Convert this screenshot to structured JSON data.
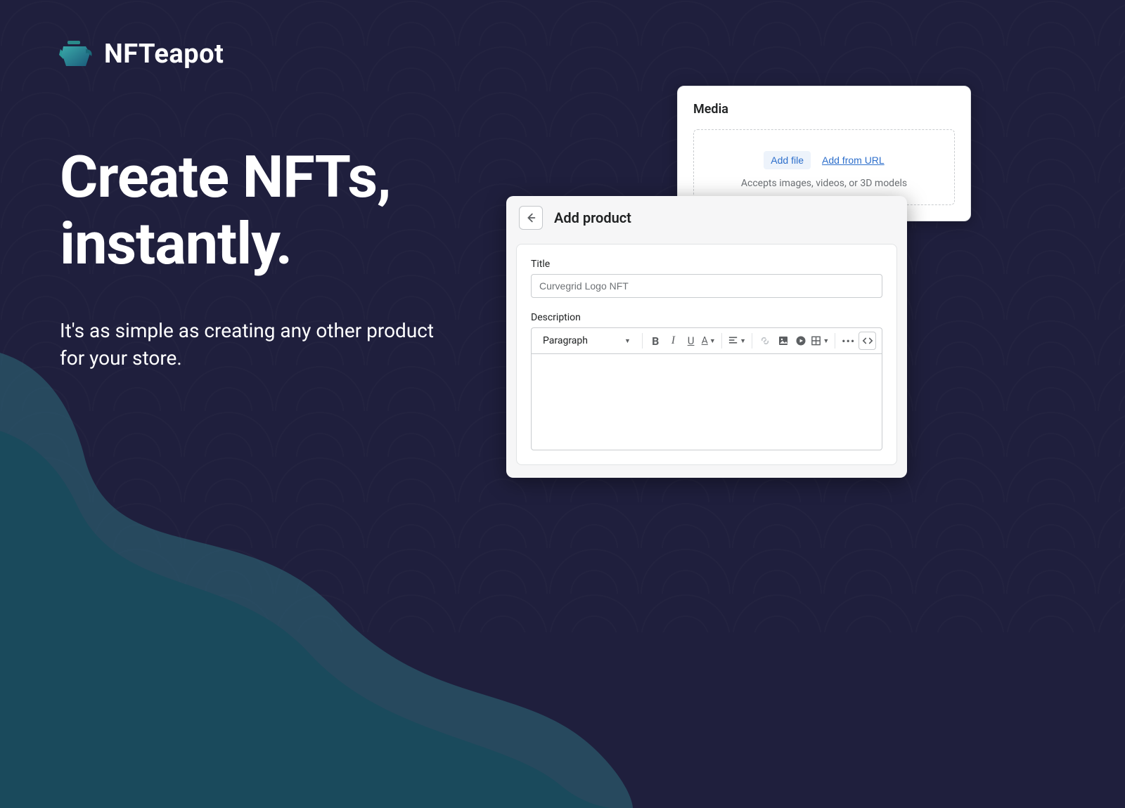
{
  "brand": {
    "name": "NFTeapot"
  },
  "hero": {
    "title_l1": "Create NFTs,",
    "title_l2": "instantly.",
    "subtitle": "It's as simple as creating any other product for your store."
  },
  "media": {
    "heading": "Media",
    "add_file": "Add file",
    "add_url": "Add from URL",
    "hint": "Accepts images, videos, or 3D models"
  },
  "product": {
    "header": "Add product",
    "title_label": "Title",
    "title_value": "Curvegrid Logo NFT",
    "description_label": "Description",
    "paragraph_label": "Paragraph"
  }
}
